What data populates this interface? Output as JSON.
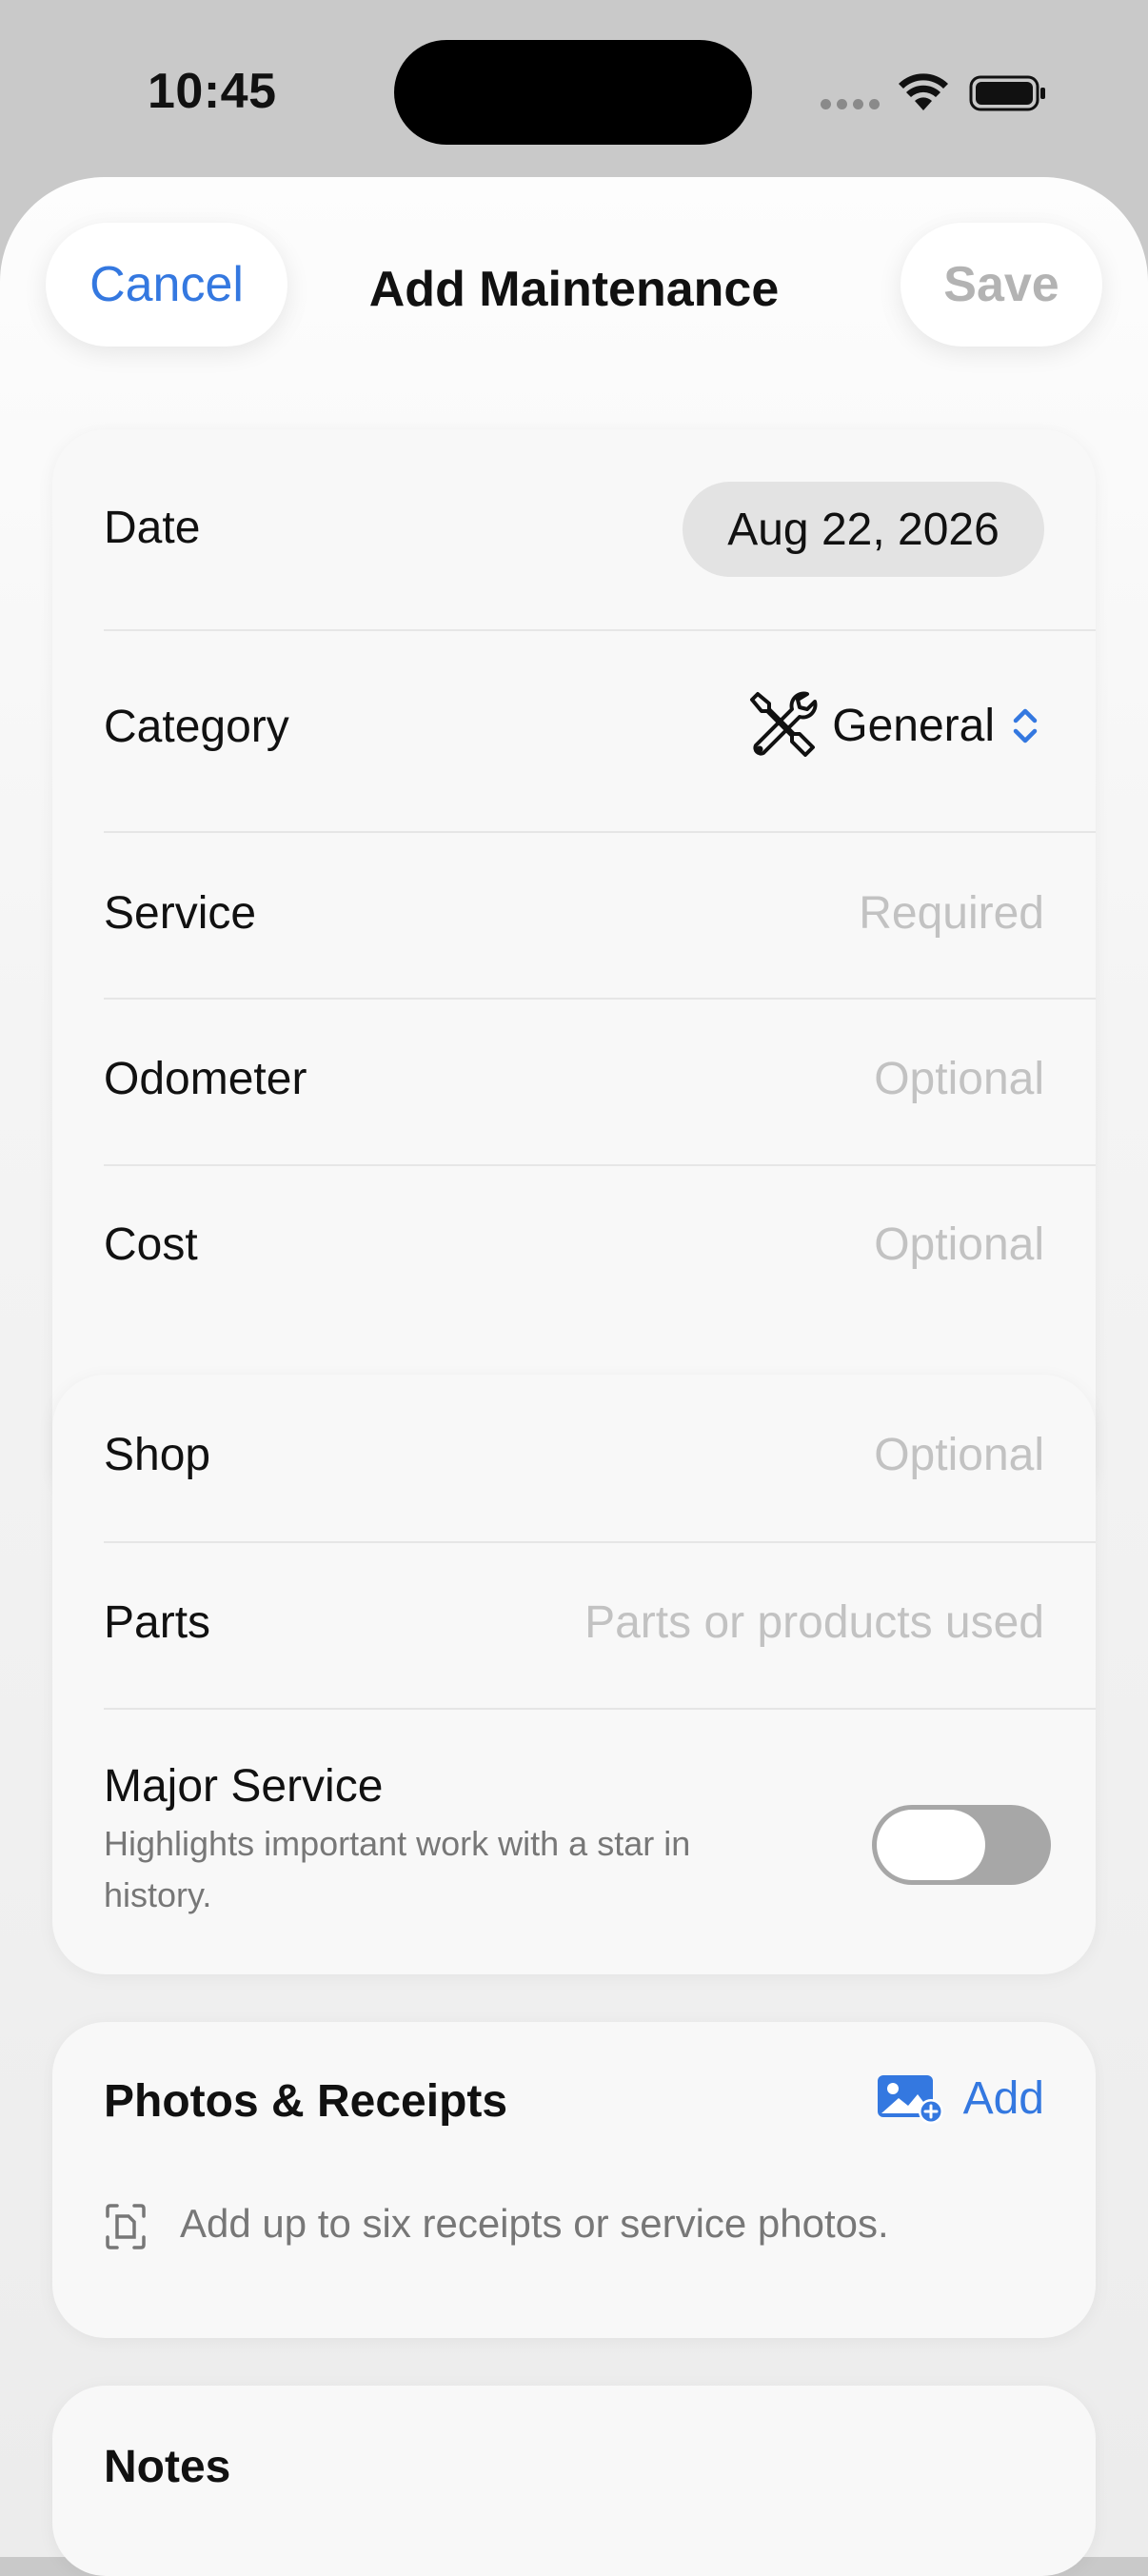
{
  "status": {
    "time": "10:45"
  },
  "nav": {
    "cancel": "Cancel",
    "title": "Add Maintenance",
    "save": "Save"
  },
  "details": {
    "date": {
      "label": "Date",
      "value": "Aug 22, 2026"
    },
    "category": {
      "label": "Category",
      "value": "General",
      "icon": "tools-icon"
    },
    "service": {
      "label": "Service",
      "placeholder": "Required"
    },
    "odometer": {
      "label": "Odometer",
      "placeholder": "Optional"
    },
    "cost": {
      "label": "Cost",
      "placeholder": "Optional"
    }
  },
  "extra": {
    "shop": {
      "label": "Shop",
      "placeholder": "Optional"
    },
    "parts": {
      "label": "Parts",
      "placeholder": "Parts or products used"
    },
    "major": {
      "label": "Major Service",
      "description": "Highlights important work with a star in history.",
      "enabled": false
    }
  },
  "photos": {
    "title": "Photos & Receipts",
    "add": "Add",
    "hint": "Add up to six receipts or service photos."
  },
  "notes": {
    "title": "Notes"
  },
  "colors": {
    "accent": "#3478e0",
    "placeholder": "#c2c2c2"
  }
}
